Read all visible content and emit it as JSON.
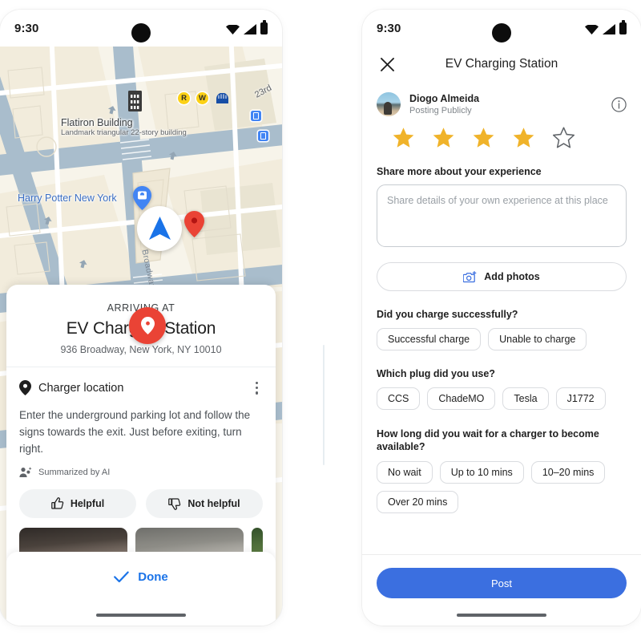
{
  "left_phone": {
    "status_bar": {
      "time": "9:30",
      "icons": [
        "wifi-icon",
        "signal-icon",
        "battery-icon"
      ]
    },
    "map": {
      "labels": {
        "flatiron_title": "Flatiron Building",
        "flatiron_subtitle": "Landmark triangular 22-story building",
        "harry_potter": "Harry Potter New York",
        "broadway": "Broadway",
        "street_23rd": "23rd"
      },
      "transit_badges": [
        "R",
        "W"
      ],
      "markers": [
        "subway-icon",
        "transit-square-icon",
        "transit-square-icon",
        "harry-potter-place-pin",
        "navigation-arrow-puck",
        "red-destination-pin",
        "green-place-pin",
        "charging-station-circle-pin"
      ]
    },
    "sheet": {
      "arriving_label": "ARRIVING AT",
      "destination_name": "EV Charging Station",
      "address": "936 Broadway, New York, NY 10010",
      "charger_section_title": "Charger location",
      "charger_description": "Enter the underground parking lot and follow the signs towards the exit. Just before exiting, turn right.",
      "ai_attribution": "Summarized by AI",
      "helpful_label": "Helpful",
      "not_helpful_label": "Not helpful",
      "photo_count": 3
    },
    "done_label": "Done"
  },
  "right_phone": {
    "status_bar": {
      "time": "9:30",
      "icons": [
        "wifi-icon",
        "signal-icon",
        "battery-icon"
      ]
    },
    "header": {
      "close_icon": "close-icon",
      "title": "EV Charging Station",
      "info_icon": "info-icon"
    },
    "user": {
      "name": "Diogo Almeida",
      "visibility": "Posting Publicly"
    },
    "rating": {
      "value": 4,
      "max": 5,
      "filled_color": "#f0b32a",
      "empty_color": "#5f6368"
    },
    "experience": {
      "label": "Share more about your experience",
      "placeholder": "Share details of your own experience at this place",
      "value": ""
    },
    "add_photos_label": "Add photos",
    "questions": [
      {
        "label": "Did you charge successfully?",
        "options": [
          "Successful charge",
          "Unable to charge"
        ]
      },
      {
        "label": "Which plug did you use?",
        "options": [
          "CCS",
          "ChadeMO",
          "Tesla",
          "J1772"
        ]
      },
      {
        "label": "How long did you wait for a charger to become available?",
        "options": [
          "No wait",
          "Up to 10 mins",
          "10–20 mins",
          "Over 20 mins"
        ]
      }
    ],
    "post_label": "Post",
    "accent_color": "#3b6fe0"
  }
}
